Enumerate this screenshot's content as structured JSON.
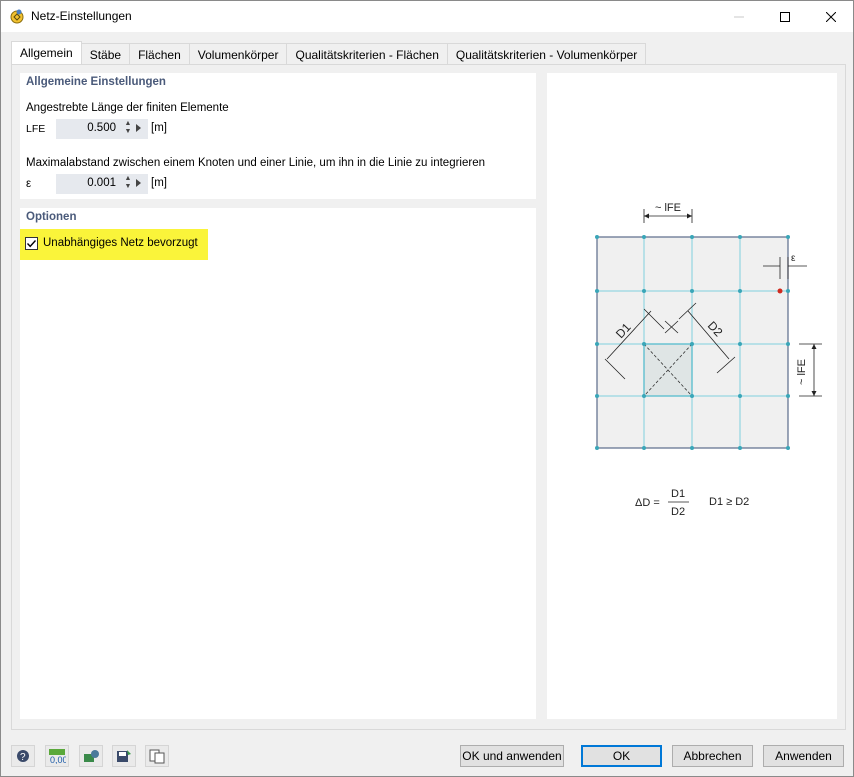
{
  "window": {
    "title": "Netz-Einstellungen",
    "icon": "mesh-settings-icon"
  },
  "tabs": [
    {
      "label": "Allgemein",
      "active": true
    },
    {
      "label": "Stäbe",
      "active": false
    },
    {
      "label": "Flächen",
      "active": false
    },
    {
      "label": "Volumenkörper",
      "active": false
    },
    {
      "label": "Qualitätskriterien - Flächen",
      "active": false
    },
    {
      "label": "Qualitätskriterien - Volumenkörper",
      "active": false
    }
  ],
  "general": {
    "title": "Allgemeine Einstellungen",
    "target_length_label": "Angestrebte Länge der finiten Elemente",
    "lfe_symbol": "LFE",
    "lfe_value": "0.500",
    "lfe_unit": "[m]",
    "max_distance_label": "Maximalabstand zwischen einem Knoten und einer Linie, um ihn in die Linie zu integrieren",
    "eps_symbol": "ε",
    "eps_value": "0.001",
    "eps_unit": "[m]"
  },
  "options": {
    "title": "Optionen",
    "independent_mesh_label": "Unabhängiges Netz bevorzugt",
    "independent_mesh_checked": true,
    "highlight_color": "#faf43a"
  },
  "diagram": {
    "lfe_top": "~ lFE",
    "lfe_side": "~ lFE",
    "eps": "ε",
    "d1": "D1",
    "d2": "D2",
    "formula_lhs": "ΔD =",
    "formula_num": "D1",
    "formula_den": "D2",
    "formula_cond": "D1 ≥ D2"
  },
  "toolbar_icons": [
    "help-icon",
    "units-icon",
    "settings-icon",
    "save-icon",
    "copy-icon"
  ],
  "buttons": {
    "ok_apply": "OK und anwenden",
    "ok": "OK",
    "cancel": "Abbrechen",
    "apply": "Anwenden"
  }
}
